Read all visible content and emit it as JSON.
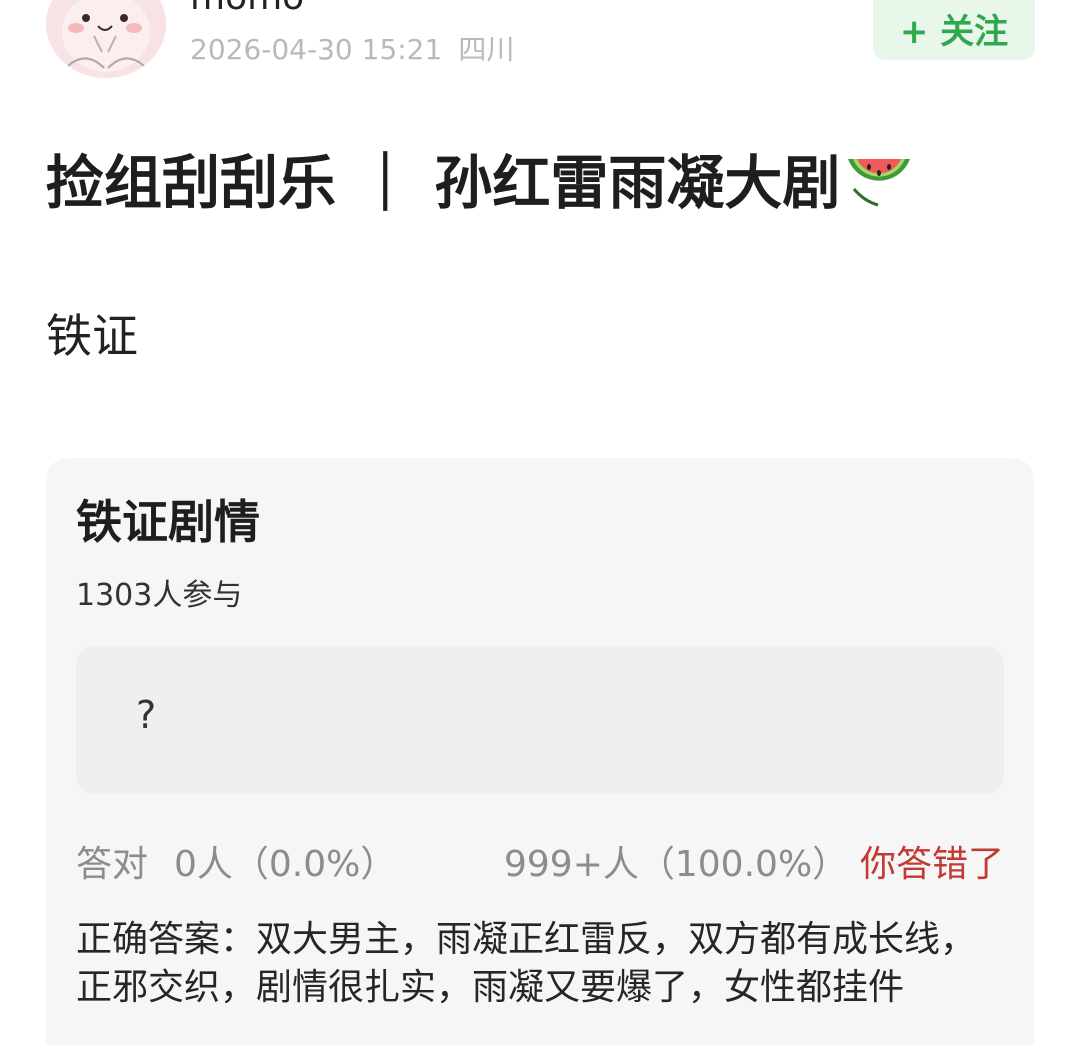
{
  "header": {
    "username": "momo",
    "timestamp": "2026-04-30 15:21",
    "location": "四川",
    "follow_label": "+ 关注"
  },
  "post": {
    "title": "捡组刮刮乐 ｜ 孙红雷雨凝大剧",
    "title_emoji": "watermelon-icon",
    "body": "铁证"
  },
  "quiz": {
    "title": "铁证剧情",
    "participants": "1303人参与",
    "answer_placeholder": "?",
    "correct_label": "答对",
    "correct_count": "0人（0.0%）",
    "wrong_count": "999+人（100.0%）",
    "result": "你答错了",
    "correct_answer": "正确答案：双大男主，雨凝正红雷反，双方都有成长线，正邪交织，剧情很扎实，雨凝又要爆了，女性都挂件"
  },
  "colors": {
    "follow_bg": "#e9f6ea",
    "follow_text": "#2fa84f",
    "wrong_text": "#c33a34",
    "card_bg": "#f6f6f6"
  }
}
